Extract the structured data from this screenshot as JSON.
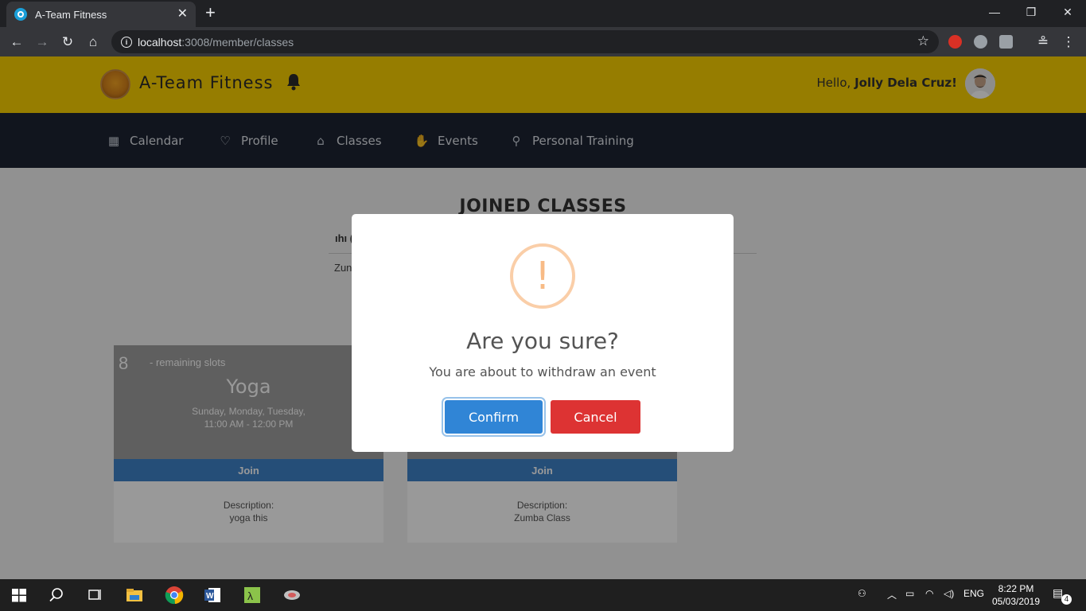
{
  "browser": {
    "tab_title": "A-Team Fitness",
    "tab_close": "✕",
    "new_tab": "+",
    "url_host": "localhost",
    "url_path": ":3008/member/classes",
    "window_minimize": "—",
    "window_restore": "❐",
    "window_close": "✕"
  },
  "header": {
    "brand": "A-Team Fitness",
    "greeting_prefix": "Hello, ",
    "user_name": "Jolly Dela Cruz!"
  },
  "nav": {
    "items": [
      {
        "label": "Calendar",
        "icon": "calendar-icon"
      },
      {
        "label": "Profile",
        "icon": "heart-icon"
      },
      {
        "label": "Classes",
        "icon": "graduation-cap-icon"
      },
      {
        "label": "Events",
        "icon": "hand-icon"
      },
      {
        "label": "Personal Training",
        "icon": "user-icon"
      }
    ]
  },
  "joined": {
    "title": "JOINED CLASSES",
    "header_fragment": "ıhı (",
    "row_fragment": "Zun"
  },
  "cards": [
    {
      "slots": "8",
      "slots_label": "- remaining slots",
      "name": "Yoga",
      "days": "Sunday, Monday, Tuesday,",
      "time": "11:00 AM - 12:00 PM",
      "join_label": "Join",
      "desc_label": "Description:",
      "desc_value": "yoga this"
    },
    {
      "join_label": "Join",
      "desc_label": "Description:",
      "desc_value": "Zumba Class"
    }
  ],
  "modal": {
    "icon": "!",
    "title": "Are you sure?",
    "text": "You are about to withdraw an event",
    "confirm_label": "Confirm",
    "cancel_label": "Cancel"
  },
  "taskbar": {
    "language": "ENG",
    "time": "8:22 PM",
    "date": "05/03/2019",
    "notification_count": "4"
  },
  "colors": {
    "header_bg": "#fbd000",
    "nav_bg": "#1d2432",
    "confirm": "#3085d6",
    "cancel": "#dd3333",
    "join": "#3f82c9",
    "warning": "#f8bb86"
  }
}
